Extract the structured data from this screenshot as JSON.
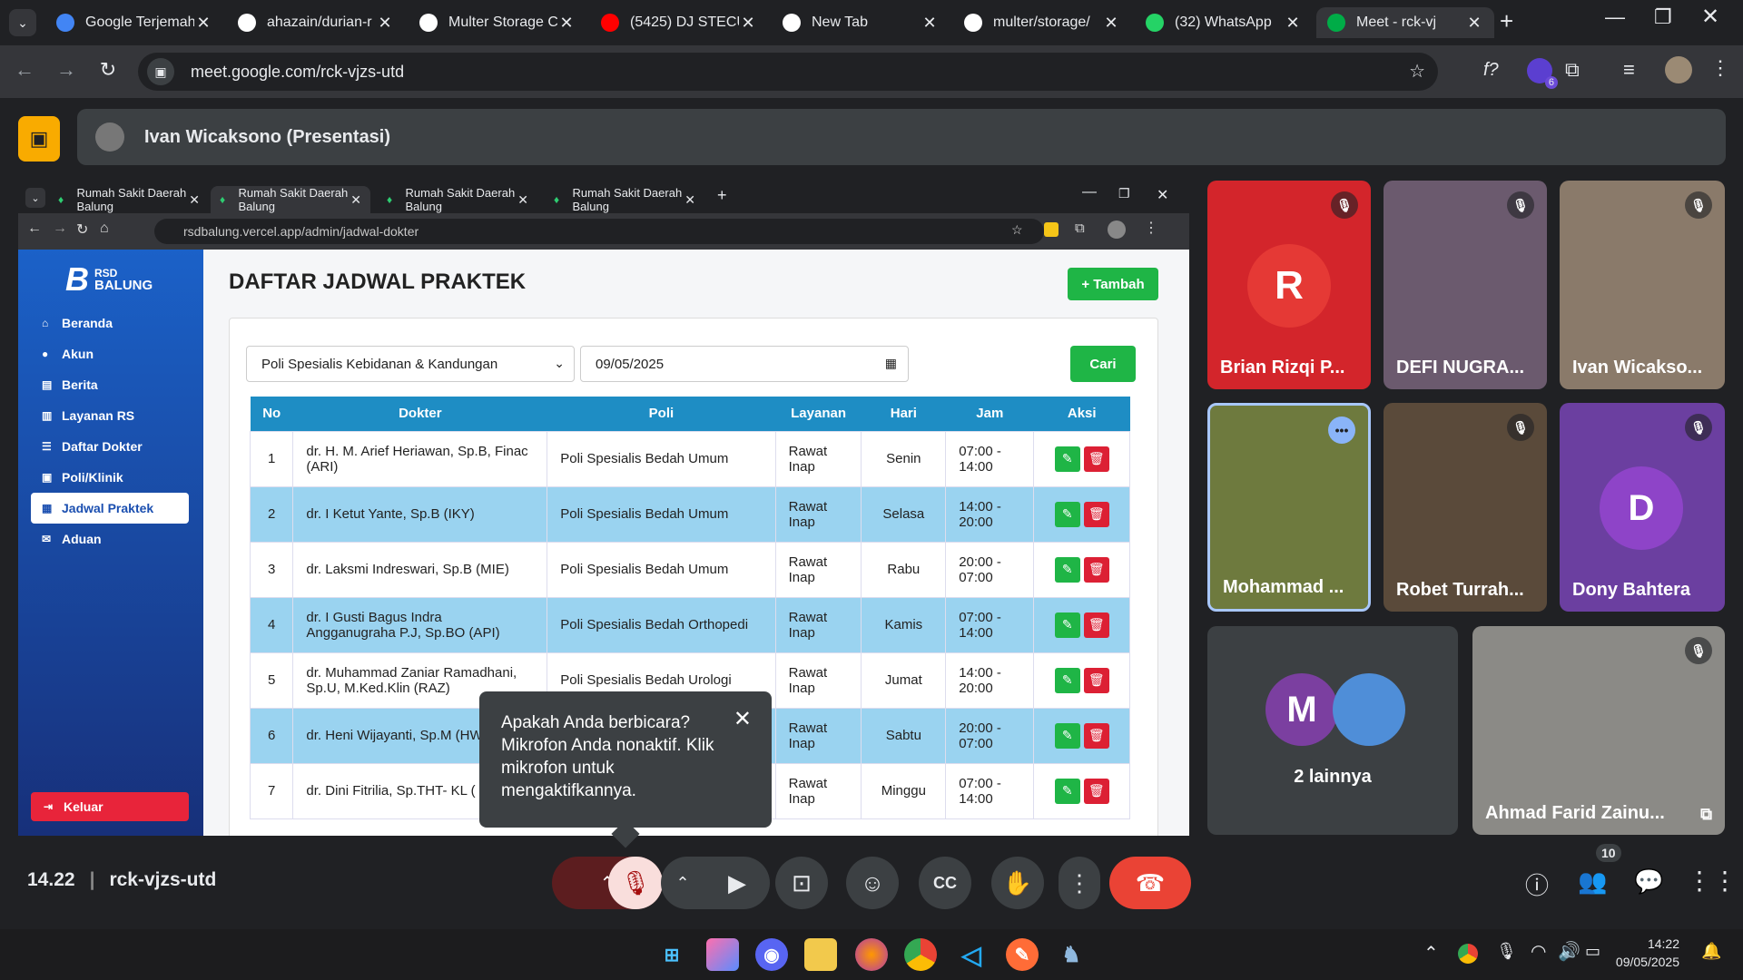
{
  "browser": {
    "tabs": [
      {
        "title": "Google Terjemah",
        "icon": "google-translate-icon",
        "color": "#4285f4"
      },
      {
        "title": "ahazain/durian-r",
        "icon": "github-icon",
        "color": "#ffffff"
      },
      {
        "title": "Multer Storage C",
        "icon": "npm-icon",
        "color": "#ffffff"
      },
      {
        "title": "(5425) DJ STECU",
        "icon": "youtube-icon",
        "color": "#ff0000"
      },
      {
        "title": "New Tab",
        "icon": "chrome-icon",
        "color": "#ffffff"
      },
      {
        "title": "multer/storage/",
        "icon": "github-icon",
        "color": "#ffffff"
      },
      {
        "title": "(32) WhatsApp",
        "icon": "whatsapp-icon",
        "color": "#25d366"
      },
      {
        "title": "Meet - rck-vj",
        "icon": "meet-icon",
        "color": "#00ac47",
        "active": true
      }
    ],
    "url": "meet.google.com/rck-vjzs-utd",
    "extension_badge": "6"
  },
  "meet": {
    "presenter_label": "Ivan Wicaksono (Presentasi)",
    "time": "14.22",
    "meeting_code": "rck-vjzs-utd",
    "participant_count": "10",
    "tooltip": {
      "text": "Apakah Anda berbicara? Mikrofon Anda nonaktif. Klik mikrofon untuk mengaktifkannya."
    },
    "tiles": [
      {
        "name": "Brian Rizqi P...",
        "muted": true
      },
      {
        "name": "DEFI NUGRA...",
        "muted": true
      },
      {
        "name": "Ivan Wicakso...",
        "muted": true
      },
      {
        "name": "Mohammad ...",
        "muted": false
      },
      {
        "name": "Robet Turrah...",
        "muted": true
      },
      {
        "name": "Dony Bahtera",
        "muted": true,
        "initial": "D"
      },
      {
        "name": "2 lainnya",
        "initial": "M"
      },
      {
        "name": "Ahmad Farid Zainu...",
        "muted": true
      }
    ]
  },
  "shared": {
    "tabs": [
      "Rumah Sakit Daerah Balung",
      "Rumah Sakit Daerah Balung",
      "Rumah Sakit Daerah Balung",
      "Rumah Sakit Daerah Balung"
    ],
    "url": "rsdbalung.vercel.app/admin/jadwal-dokter",
    "logo_text": [
      "RSD",
      "BALUNG"
    ],
    "sidebar": [
      "Beranda",
      "Akun",
      "Berita",
      "Layanan RS",
      "Daftar Dokter",
      "Poli/Klinik",
      "Jadwal Praktek",
      "Aduan"
    ],
    "logout": "Keluar",
    "title": "DAFTAR JADWAL PRAKTEK",
    "add_label": "+ Tambah",
    "filter_poli": "Poli Spesialis Kebidanan & Kandungan",
    "filter_date": "09/05/2025",
    "search_label": "Cari",
    "table": {
      "headers": [
        "No",
        "Dokter",
        "Poli",
        "Layanan",
        "Hari",
        "Jam",
        "Aksi"
      ],
      "rows": [
        [
          "1",
          "dr. H. M. Arief Heriawan, Sp.B, Finac (ARI)",
          "Poli Spesialis Bedah Umum",
          "Rawat Inap",
          "Senin",
          "07:00 - 14:00"
        ],
        [
          "2",
          "dr. I Ketut Yante, Sp.B (IKY)",
          "Poli Spesialis Bedah Umum",
          "Rawat Inap",
          "Selasa",
          "14:00 - 20:00"
        ],
        [
          "3",
          "dr. Laksmi Indreswari, Sp.B (MIE)",
          "Poli Spesialis Bedah Umum",
          "Rawat Inap",
          "Rabu",
          "20:00 - 07:00"
        ],
        [
          "4",
          "dr. I Gusti Bagus Indra Angganugraha P.J, Sp.BO (API)",
          "Poli Spesialis Bedah Orthopedi",
          "Rawat Inap",
          "Kamis",
          "07:00 - 14:00"
        ],
        [
          "5",
          "dr. Muhammad Zaniar Ramadhani, Sp.U, M.Ked.Klin (RAZ)",
          "Poli Spesialis Bedah Urologi",
          "Rawat Inap",
          "Jumat",
          "14:00 - 20:00"
        ],
        [
          "6",
          "dr. Heni Wijayanti, Sp.M (HW)",
          "",
          "Rawat Inap",
          "Sabtu",
          "20:00 - 07:00"
        ],
        [
          "7",
          "dr. Dini Fitrilia, Sp.THT- KL (",
          "",
          "Rawat Inap",
          "Minggu",
          "07:00 - 14:00"
        ]
      ]
    }
  },
  "taskbar": {
    "time": "14:22",
    "date": "09/05/2025"
  }
}
